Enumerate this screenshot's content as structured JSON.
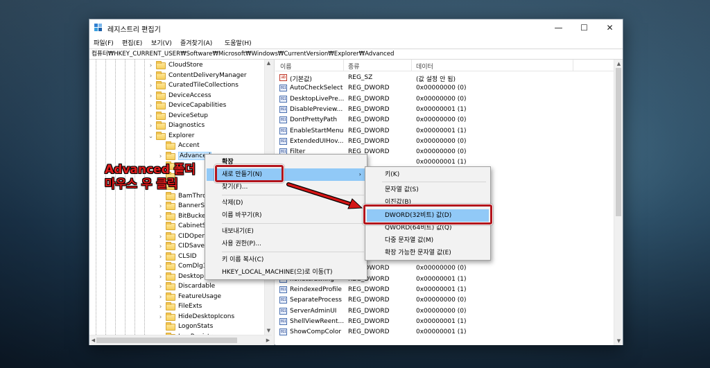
{
  "window": {
    "title": "레지스트리 편집기",
    "minimize_glyph": "—",
    "maximize_glyph": "☐",
    "close_glyph": "✕"
  },
  "menu": [
    "파일(F)",
    "편집(E)",
    "보기(V)",
    "즐겨찾기(A)",
    "도움말(H)"
  ],
  "path": "컴퓨터₩HKEY_CURRENT_USER₩Software₩Microsoft₩Windows₩CurrentVersion₩Explorer₩Advanced",
  "tree": {
    "items": [
      {
        "label": "CloudStore",
        "level": 1,
        "toggle": "›"
      },
      {
        "label": "ContentDeliveryManager",
        "level": 1,
        "toggle": "›"
      },
      {
        "label": "CuratedTileCollections",
        "level": 1,
        "toggle": "›"
      },
      {
        "label": "DeviceAccess",
        "level": 1,
        "toggle": "›"
      },
      {
        "label": "DeviceCapabilities",
        "level": 1,
        "toggle": "›"
      },
      {
        "label": "DeviceSetup",
        "level": 1,
        "toggle": "›"
      },
      {
        "label": "Diagnostics",
        "level": 1,
        "toggle": "›"
      },
      {
        "label": "Explorer",
        "level": 1,
        "toggle": "⌄"
      },
      {
        "label": "Accent",
        "level": 2,
        "toggle": ""
      },
      {
        "label": "Advanced",
        "level": 2,
        "toggle": "›"
      },
      {
        "label": "",
        "level": 2,
        "toggle": ""
      },
      {
        "label": "",
        "level": 2,
        "toggle": ""
      },
      {
        "label": "",
        "level": 2,
        "toggle": ""
      },
      {
        "label": "BamThrot",
        "level": 2,
        "toggle": ""
      },
      {
        "label": "BannerSto",
        "level": 2,
        "toggle": "›"
      },
      {
        "label": "BitBucket",
        "level": 2,
        "toggle": "›"
      },
      {
        "label": "CabinetSt",
        "level": 2,
        "toggle": ""
      },
      {
        "label": "CIDOpen",
        "level": 2,
        "toggle": "›"
      },
      {
        "label": "CIDSave",
        "level": 2,
        "toggle": "›"
      },
      {
        "label": "CLSID",
        "level": 2,
        "toggle": "›"
      },
      {
        "label": "ComDlg3",
        "level": 2,
        "toggle": "›"
      },
      {
        "label": "Desktop",
        "level": 2,
        "toggle": "›"
      },
      {
        "label": "Discardable",
        "level": 2,
        "toggle": "›"
      },
      {
        "label": "FeatureUsage",
        "level": 2,
        "toggle": "›"
      },
      {
        "label": "FileExts",
        "level": 2,
        "toggle": "›"
      },
      {
        "label": "HideDesktopIcons",
        "level": 2,
        "toggle": "›"
      },
      {
        "label": "LogonStats",
        "level": 2,
        "toggle": ""
      },
      {
        "label": "LowRegistry",
        "level": 2,
        "toggle": "›"
      }
    ]
  },
  "list": {
    "headers": {
      "name": "이름",
      "type": "종류",
      "data": "데이터"
    },
    "rows": [
      {
        "name": "(기본값)",
        "type": "REG_SZ",
        "data": "(값 설정 안 됨)",
        "icon": "ab"
      },
      {
        "name": "AutoCheckSelect",
        "type": "REG_DWORD",
        "data": "0x00000000 (0)",
        "icon": "011"
      },
      {
        "name": "DesktopLivePre...",
        "type": "REG_DWORD",
        "data": "0x00000000 (0)",
        "icon": "011"
      },
      {
        "name": "DisablePreview...",
        "type": "REG_DWORD",
        "data": "0x00000001 (1)",
        "icon": "011"
      },
      {
        "name": "DontPrettyPath",
        "type": "REG_DWORD",
        "data": "0x00000000 (0)",
        "icon": "011"
      },
      {
        "name": "EnableStartMenu",
        "type": "REG_DWORD",
        "data": "0x00000001 (1)",
        "icon": "011"
      },
      {
        "name": "ExtendedUIHov...",
        "type": "REG_DWORD",
        "data": "0x00000000 (0)",
        "icon": "011"
      },
      {
        "name": "Filter",
        "type": "REG_DWORD",
        "data": "0x00000000 (0)",
        "icon": "011"
      },
      {
        "name": "",
        "type": "",
        "data": "0x00000001 (1)",
        "icon": "011"
      },
      {
        "name": "",
        "type": "",
        "data": "",
        "icon": "011"
      },
      {
        "name": "",
        "type": "",
        "data": "",
        "icon": "011"
      },
      {
        "name": "",
        "type": "",
        "data": "",
        "icon": "011"
      },
      {
        "name": "",
        "type": "",
        "data": "",
        "icon": "011"
      },
      {
        "name": "",
        "type": "",
        "data": "",
        "icon": "011"
      },
      {
        "name": "",
        "type": "",
        "data": "",
        "icon": "011"
      },
      {
        "name": "",
        "type": "",
        "data": "",
        "icon": "011"
      },
      {
        "name": "",
        "type": "",
        "data": "0x00000001 (1)",
        "icon": "011"
      },
      {
        "name": "",
        "type": "REG_DWORD",
        "data": "0x00000000 (0)",
        "icon": "011"
      },
      {
        "name": "NavPaneShowA...",
        "type": "REG_DWORD",
        "data": "0x00000000 (0)",
        "icon": "011"
      },
      {
        "name": "nonetcrawling",
        "type": "REG_DWORD",
        "data": "0x00000001 (1)",
        "icon": "011"
      },
      {
        "name": "ReindexedProfile",
        "type": "REG_DWORD",
        "data": "0x00000001 (1)",
        "icon": "011"
      },
      {
        "name": "SeparateProcess",
        "type": "REG_DWORD",
        "data": "0x00000000 (0)",
        "icon": "011"
      },
      {
        "name": "ServerAdminUI",
        "type": "REG_DWORD",
        "data": "0x00000000 (0)",
        "icon": "011"
      },
      {
        "name": "ShellViewReent...",
        "type": "REG_DWORD",
        "data": "0x00000001 (1)",
        "icon": "011"
      },
      {
        "name": "ShowCompColor",
        "type": "REG_DWORD",
        "data": "0x00000001 (1)",
        "icon": "011"
      }
    ]
  },
  "context_menu": {
    "items": [
      {
        "label": "확장",
        "bold": true
      },
      {
        "label": "새로 만들기(N)",
        "submenu_arrow": "›"
      },
      {
        "label": "찾기(F)..."
      },
      {
        "label": "삭제(D)"
      },
      {
        "label": "이름 바꾸기(R)"
      },
      {
        "label": "내보내기(E)"
      },
      {
        "label": "사용 권한(P)..."
      },
      {
        "label": "키 이름 복사(C)"
      },
      {
        "label": "HKEY_LOCAL_MACHINE(으)로 이동(T)"
      }
    ]
  },
  "submenu": {
    "items": [
      {
        "label": "키(K)"
      },
      {
        "label": "문자열 값(S)"
      },
      {
        "label": "이진값(B)"
      },
      {
        "label": "DWORD(32비트) 값(D)"
      },
      {
        "label": "QWORD(64비트) 값(Q)"
      },
      {
        "label": "다중 문자열 값(M)"
      },
      {
        "label": "확장 가능한 문자열 값(E)"
      }
    ]
  },
  "annotation": {
    "line1": "Advanced 폴더",
    "line2": "마우스 우 클릭"
  },
  "colors": {
    "highlight": "#91c9f7",
    "annotation_red": "#e11c1c",
    "box_red": "#b3141c"
  }
}
